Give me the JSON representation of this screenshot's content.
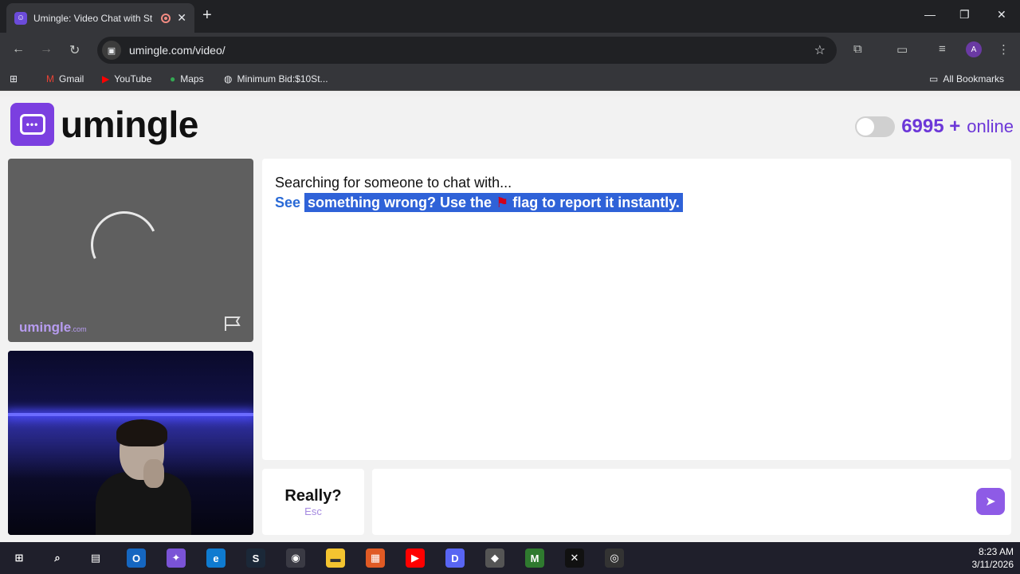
{
  "browser": {
    "tab_title": "Umingle: Video Chat with St",
    "new_tab": "+",
    "url": "umingle.com/video/",
    "profile_initial": "A",
    "bookmarks": [
      {
        "label": "Gmail"
      },
      {
        "label": "YouTube"
      },
      {
        "label": "Maps"
      },
      {
        "label": "Minimum Bid:$10St..."
      }
    ],
    "all_bookmarks": "All Bookmarks"
  },
  "header": {
    "brand": "umingle",
    "online_count": "6995 +",
    "online_label": "online"
  },
  "stranger_video": {
    "watermark": "umingle",
    "watermark_suffix": ".com"
  },
  "chat": {
    "status": "Searching for someone to chat with...",
    "tip_see": "See",
    "tip_part1": "something wrong? Use the",
    "tip_part2": "flag to report it instantly."
  },
  "controls": {
    "stop_label": "Really?",
    "stop_key": "Esc",
    "message_placeholder": ""
  },
  "taskbar": {
    "time": "8:23 AM",
    "date": "3/11/2026"
  },
  "colors": {
    "accent": "#7b3fe0",
    "selection": "#2f62d8",
    "link_blue": "#2a6ad6"
  }
}
